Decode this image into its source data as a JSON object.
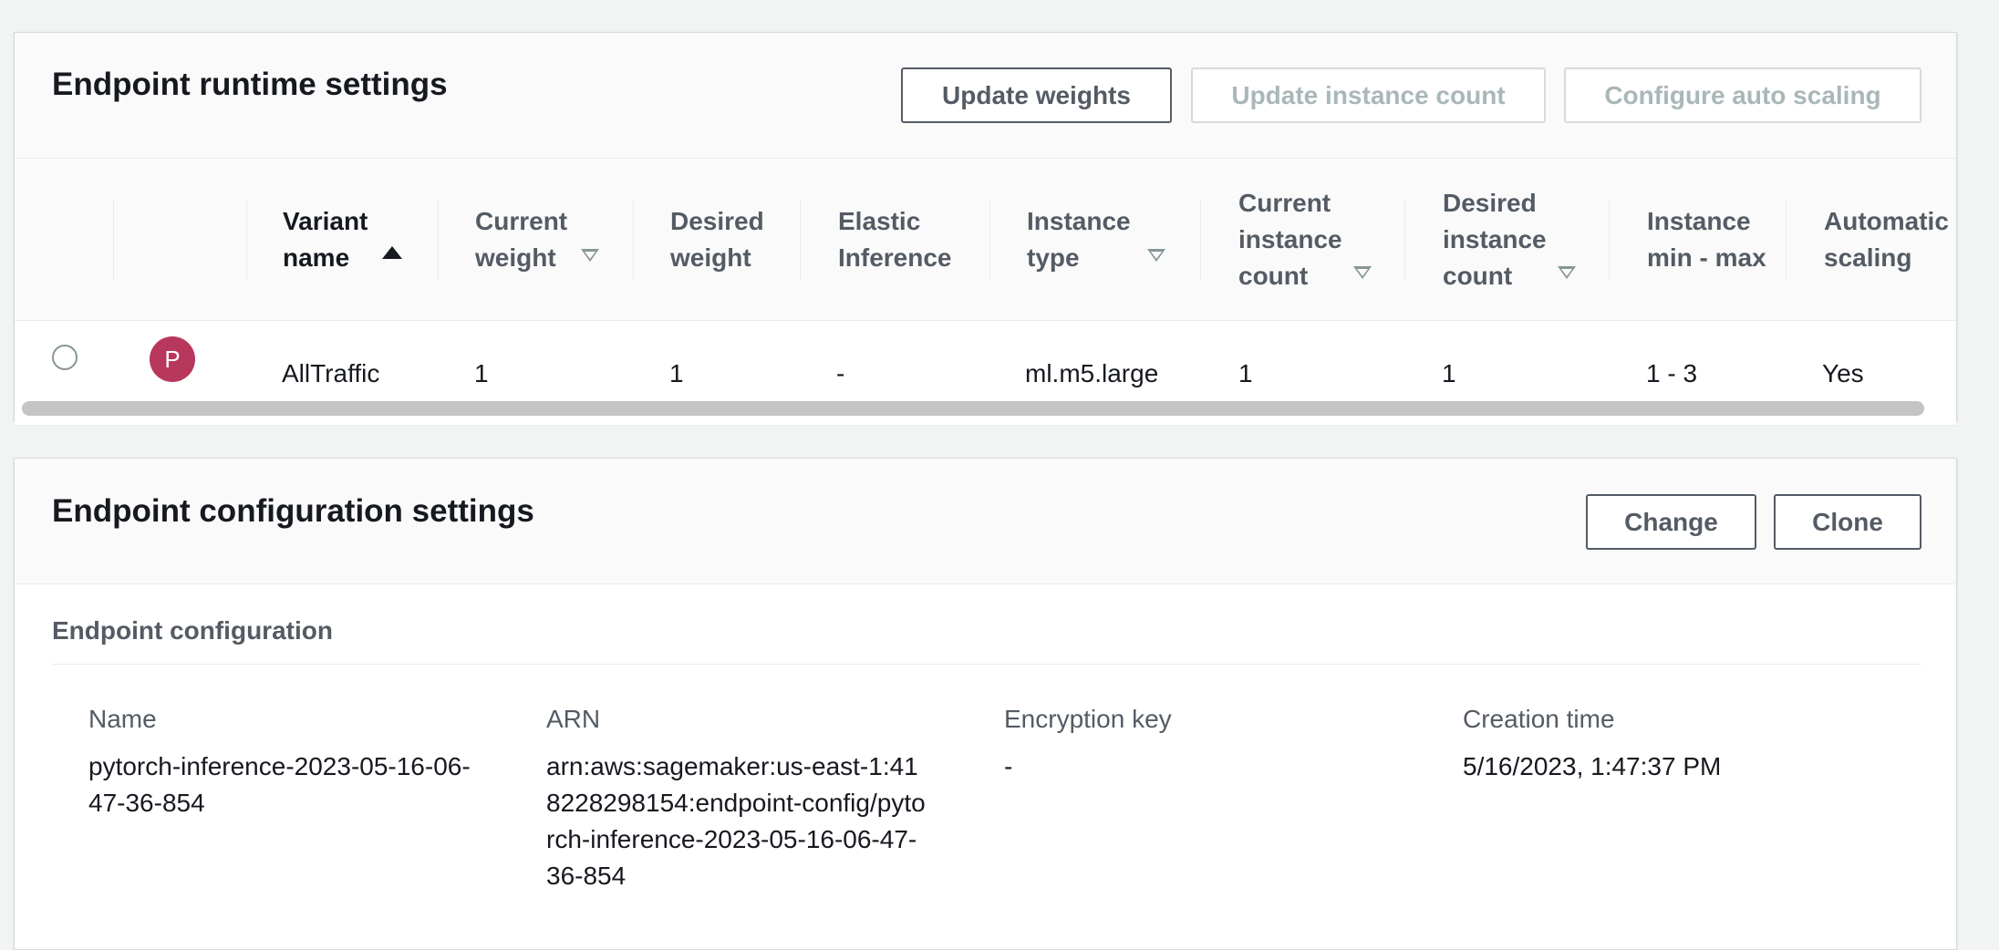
{
  "runtime": {
    "title": "Endpoint runtime settings",
    "buttons": {
      "update_weights": "Update weights",
      "update_instance_count": "Update instance count",
      "configure_auto_scaling": "Configure auto scaling"
    },
    "columns": [
      "Variant name",
      "Current weight",
      "Desired weight",
      "Elastic Inference",
      "Instance type",
      "Current instance count",
      "Desired instance count",
      "Instance min - max",
      "Automatic scaling"
    ],
    "sort": {
      "column": "Variant name",
      "direction": "ascending"
    },
    "rows": [
      {
        "avatar_letter": "P",
        "variant_name": "AllTraffic",
        "current_weight": "1",
        "desired_weight": "1",
        "elastic_inference": "-",
        "instance_type": "ml.m5.large",
        "current_instance_count": "1",
        "desired_instance_count": "1",
        "instance_min_max": "1 - 3",
        "automatic_scaling": "Yes"
      }
    ]
  },
  "config": {
    "title": "Endpoint configuration settings",
    "buttons": {
      "change": "Change",
      "clone": "Clone"
    },
    "section_title": "Endpoint configuration",
    "fields": {
      "name": {
        "label": "Name",
        "value": "pytorch-inference-2023-05-16-06-47-36-854"
      },
      "arn": {
        "label": "ARN",
        "value": "arn:aws:sagemaker:us-east-1:418228298154:endpoint-config/pytorch-inference-2023-05-16-06-47-36-854"
      },
      "encryption_key": {
        "label": "Encryption key",
        "value": "-"
      },
      "creation_time": {
        "label": "Creation time",
        "value": "5/16/2023, 1:47:37 PM"
      }
    }
  },
  "colors": {
    "avatar": "#b8375d",
    "text": "#16191f",
    "secondary_text": "#545b64",
    "disabled_text": "#aab7b8",
    "border": "#d5dbdb"
  }
}
